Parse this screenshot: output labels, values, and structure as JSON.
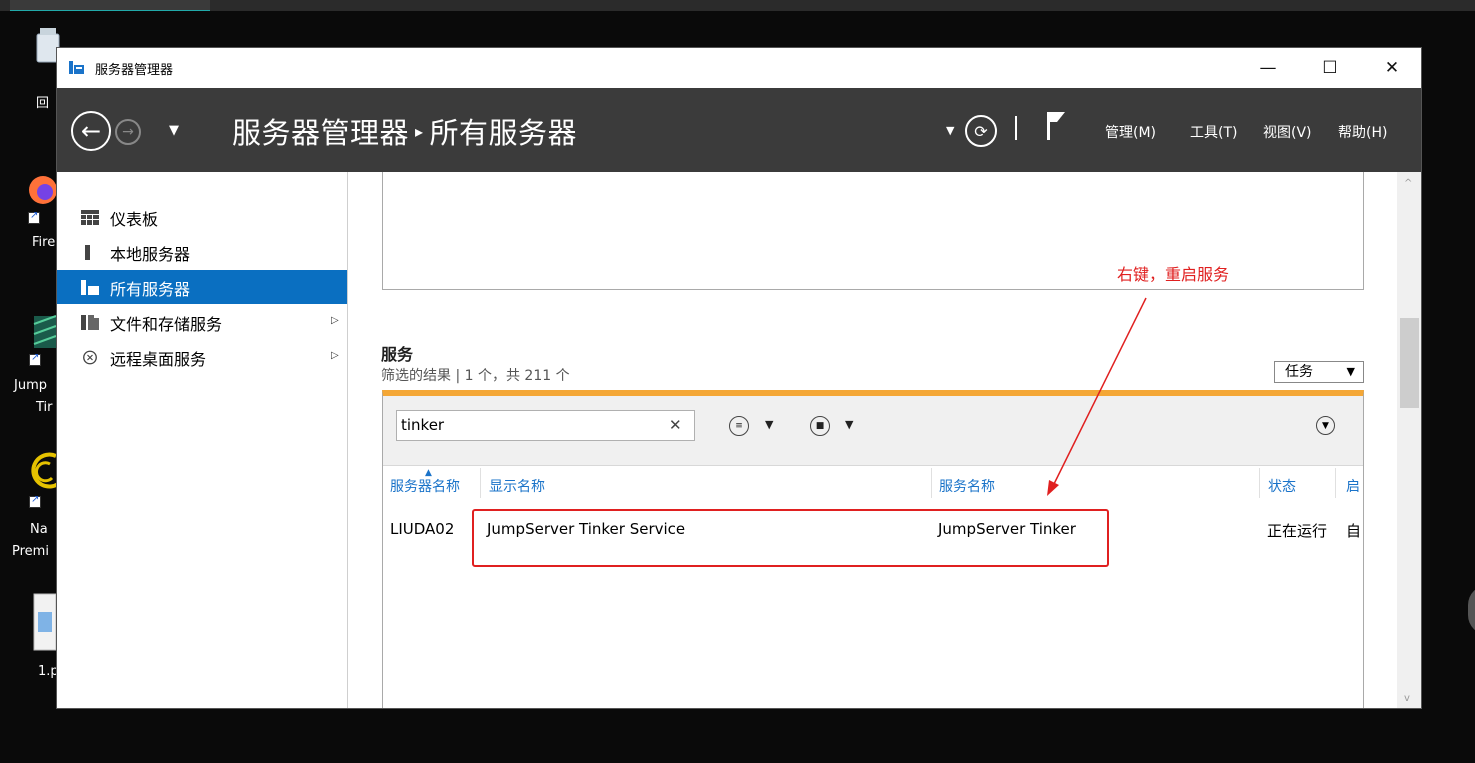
{
  "window": {
    "title": "服务器管理器",
    "minimize": "—",
    "maximize": "☐",
    "close": "✕"
  },
  "header": {
    "breadcrumb_root": "服务器管理器",
    "breadcrumb_sep": "▸",
    "breadcrumb_current": "所有服务器",
    "menus": [
      "管理(M)",
      "工具(T)",
      "视图(V)",
      "帮助(H)"
    ]
  },
  "desktop": {
    "labels": [
      "回",
      "Fire",
      "Jump",
      "Tir",
      "Na",
      "Premi",
      "1.p"
    ]
  },
  "nav": {
    "items": [
      {
        "label": "仪表板"
      },
      {
        "label": "本地服务器"
      },
      {
        "label": "所有服务器"
      },
      {
        "label": "文件和存储服务"
      },
      {
        "label": "远程桌面服务"
      }
    ]
  },
  "services": {
    "title": "服务",
    "subtitle": "筛选的结果 | 1 个，共 211 个",
    "tasks_label": "任务",
    "filter_value": "tinker",
    "columns": [
      "服务器名称",
      "显示名称",
      "服务名称",
      "状态",
      "启"
    ],
    "rows": [
      {
        "server": "LIUDA02",
        "display": "JumpServer Tinker Service",
        "service": "JumpServer Tinker",
        "status": "正在运行",
        "start": "自"
      }
    ]
  },
  "annotation": {
    "text": "右键，重启服务",
    "color": "#e02020"
  },
  "colors": {
    "header_bg": "#3b3b3b",
    "nav_selected": "#0a6fc1",
    "grid_accent": "#f4a736",
    "column_header": "#1a73c9"
  }
}
